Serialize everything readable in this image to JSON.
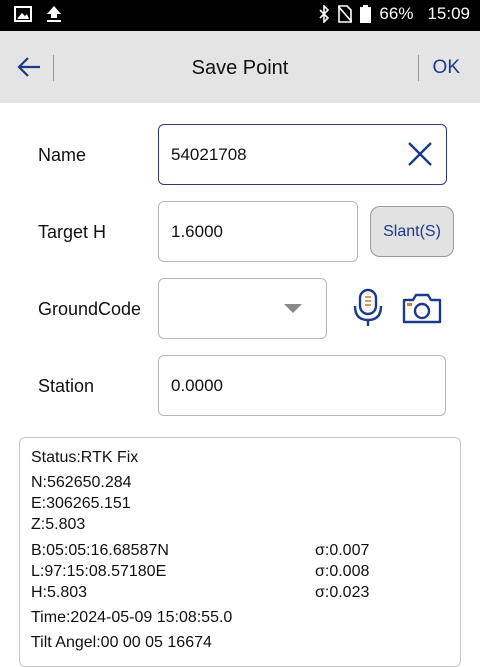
{
  "statusbar": {
    "battery_percent": "66%",
    "time": "15:09"
  },
  "header": {
    "title": "Save Point",
    "ok_label": "OK"
  },
  "form": {
    "name_label": "Name",
    "name_value": "54021708",
    "target_h_label": "Target H",
    "target_h_value": "1.6000",
    "slant_label": "Slant(S)",
    "groundcode_label": "GroundCode",
    "groundcode_value": "",
    "station_label": "Station",
    "station_value": "0.0000"
  },
  "info": {
    "status": "Status:RTK Fix",
    "n": "N:562650.284",
    "e": "E:306265.151",
    "z": "Z:5.803",
    "b": "B:05:05:16.68587N",
    "l": "L:97:15:08.57180E",
    "h": "H:5.803",
    "sigma_b": "σ:0.007",
    "sigma_l": "σ:0.008",
    "sigma_h": "σ:0.023",
    "time": "Time:2024-05-09 15:08:55.0",
    "tilt_partial": "Tilt Angel:00 00 05 16674"
  },
  "colors": {
    "accent": "#1a3a8a",
    "header_bg": "#e4e4e4",
    "statusbar_bg": "#000000"
  }
}
